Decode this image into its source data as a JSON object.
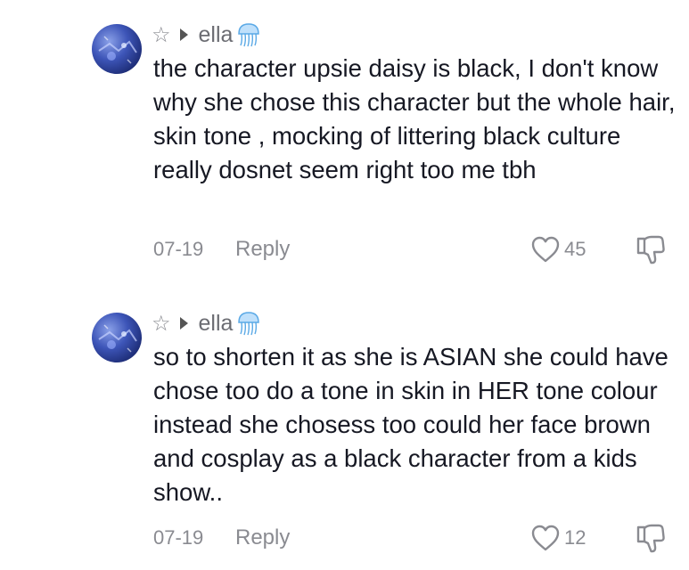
{
  "comments": [
    {
      "username": "ella",
      "text": "the character upsie daisy is black, I don't know why she chose this character but the whole hair, skin tone , mocking of littering black culture really dosnet seem right too me tbh",
      "date": "07-19",
      "reply_label": "Reply",
      "likes": "45"
    },
    {
      "username": "ella",
      "text": "so to shorten it as she is ASIAN she could have chose too do a tone in skin in HER tone colour instead she chosess too could her face brown and cosplay as a black character from a kids show..",
      "date": "07-19",
      "reply_label": "Reply",
      "likes": "12"
    }
  ],
  "icons": {
    "star": "star-outline-icon",
    "arrow": "play-arrow-icon",
    "badge": "jellyfish-emoji-icon",
    "like": "heart-outline-icon",
    "dislike": "thumbs-down-outline-icon"
  },
  "colors": {
    "text": "#161823",
    "secondary": "#8a8b91",
    "jellyfish": "#5aa9e6"
  }
}
